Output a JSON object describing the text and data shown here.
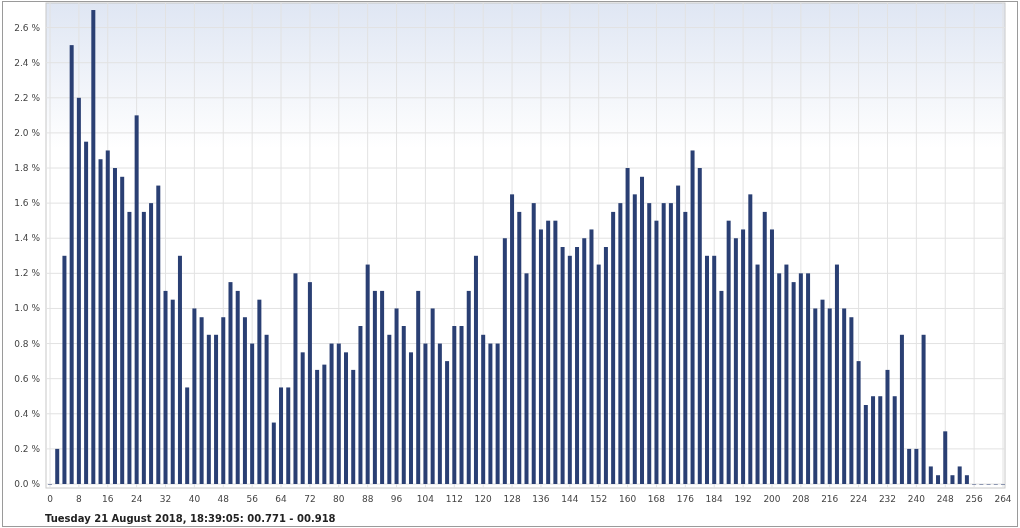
{
  "chart": {
    "chart_data": {
      "type": "bar",
      "x": [
        0,
        2,
        4,
        6,
        8,
        10,
        12,
        14,
        16,
        18,
        20,
        22,
        24,
        26,
        28,
        30,
        32,
        34,
        36,
        38,
        40,
        42,
        44,
        46,
        48,
        50,
        52,
        54,
        56,
        58,
        60,
        62,
        64,
        66,
        68,
        70,
        72,
        74,
        76,
        78,
        80,
        82,
        84,
        86,
        88,
        90,
        92,
        94,
        96,
        98,
        100,
        102,
        104,
        106,
        108,
        110,
        112,
        114,
        116,
        118,
        120,
        122,
        124,
        126,
        128,
        130,
        132,
        134,
        136,
        138,
        140,
        142,
        144,
        146,
        148,
        150,
        152,
        154,
        156,
        158,
        160,
        162,
        164,
        166,
        168,
        170,
        172,
        174,
        176,
        178,
        180,
        182,
        184,
        186,
        188,
        190,
        192,
        194,
        196,
        198,
        200,
        202,
        204,
        206,
        208,
        210,
        212,
        214,
        216,
        218,
        220,
        222,
        224,
        226,
        228,
        230,
        232,
        234,
        236,
        238,
        240,
        242,
        244,
        246,
        248,
        250,
        252,
        254,
        256,
        258,
        260,
        262,
        264
      ],
      "grid": true,
      "values": [
        0,
        0.2,
        1.3,
        2.5,
        2.2,
        1.95,
        2.7,
        1.85,
        1.9,
        1.8,
        1.75,
        1.55,
        2.1,
        1.55,
        1.6,
        1.7,
        1.1,
        1.05,
        1.3,
        0.55,
        1.0,
        0.95,
        0.85,
        0.85,
        0.95,
        1.15,
        1.1,
        0.95,
        0.8,
        1.05,
        0.85,
        0.35,
        0.55,
        0.55,
        1.2,
        0.75,
        1.15,
        0.65,
        0.68,
        0.8,
        0.8,
        0.75,
        0.65,
        0.9,
        1.25,
        1.1,
        1.1,
        0.85,
        1.0,
        0.9,
        0.75,
        1.1,
        0.8,
        1.0,
        0.8,
        0.7,
        0.9,
        0.9,
        1.1,
        1.3,
        0.85,
        0.8,
        0.8,
        1.4,
        1.65,
        1.55,
        1.2,
        1.6,
        1.45,
        1.5,
        1.5,
        1.35,
        1.3,
        1.35,
        1.4,
        1.45,
        1.25,
        1.35,
        1.55,
        1.6,
        1.8,
        1.65,
        1.75,
        1.6,
        1.5,
        1.6,
        1.6,
        1.7,
        1.55,
        1.9,
        1.8,
        1.3,
        1.3,
        1.1,
        1.5,
        1.4,
        1.45,
        1.65,
        1.25,
        1.55,
        1.45,
        1.2,
        1.25,
        1.15,
        1.2,
        1.2,
        1.0,
        1.05,
        1.0,
        1.25,
        1.0,
        0.95,
        0.7,
        0.45,
        0.5,
        0.5,
        0.65,
        0.5,
        0.85,
        0.2,
        0.2,
        0.85,
        0.1,
        0.05,
        0.3,
        0.05,
        0.1,
        0.05,
        0,
        0,
        0,
        0,
        0
      ],
      "xlim": [
        0,
        264
      ],
      "ylim": [
        0,
        2.74
      ],
      "xticks": [
        0,
        8,
        16,
        24,
        32,
        40,
        48,
        56,
        64,
        72,
        80,
        88,
        96,
        104,
        112,
        120,
        128,
        136,
        144,
        152,
        160,
        168,
        176,
        184,
        192,
        200,
        208,
        216,
        224,
        232,
        240,
        248,
        256,
        264
      ],
      "yticks": [
        {
          "value": 0,
          "label": "0.0 %"
        },
        {
          "value": 0.2,
          "label": "0.2 %"
        },
        {
          "value": 0.4,
          "label": "0.4 %"
        },
        {
          "value": 0.6,
          "label": "0.6 %"
        },
        {
          "value": 0.8,
          "label": "0.8 %"
        },
        {
          "value": 1.0,
          "label": "1.0 %"
        },
        {
          "value": 1.2,
          "label": "1.2 %"
        },
        {
          "value": 1.4,
          "label": "1.4 %"
        },
        {
          "value": 1.6,
          "label": "1.6 %"
        },
        {
          "value": 1.8,
          "label": "1.8 %"
        },
        {
          "value": 2.0,
          "label": "2.0 %"
        },
        {
          "value": 2.2,
          "label": "2.2 %"
        },
        {
          "value": 2.4,
          "label": "2.4 %"
        },
        {
          "value": 2.6,
          "label": "2.6 %"
        }
      ]
    },
    "caption": "Tuesday 21 August 2018, 18:39:05: 00.771 - 00.918"
  }
}
